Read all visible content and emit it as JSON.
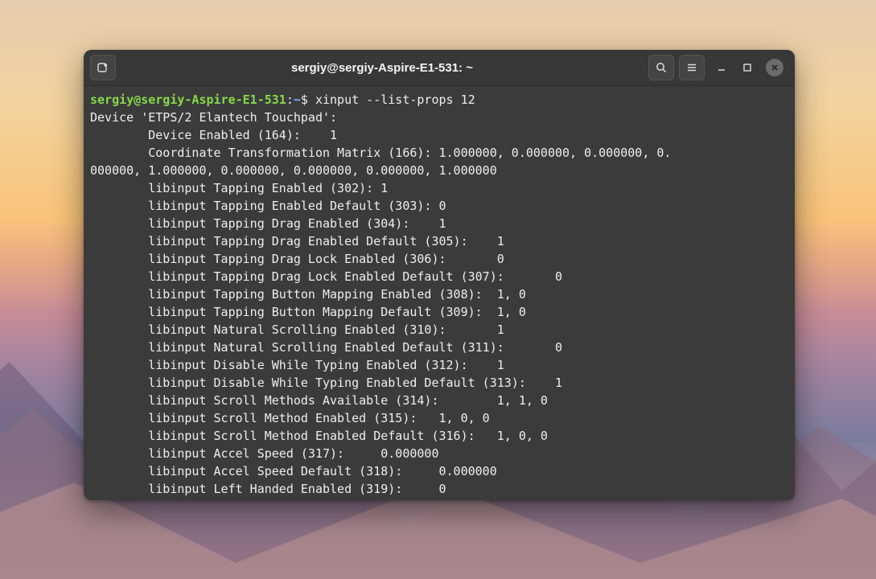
{
  "window": {
    "title": "sergiy@sergiy-Aspire-E1-531: ~"
  },
  "prompt": {
    "user_host": "sergiy@sergiy-Aspire-E1-531",
    "colon": ":",
    "path": "~",
    "dollar": "$ ",
    "command": "xinput --list-props 12"
  },
  "output_lines": [
    "Device 'ETPS/2 Elantech Touchpad':",
    "        Device Enabled (164):    1",
    "        Coordinate Transformation Matrix (166): 1.000000, 0.000000, 0.000000, 0.",
    "000000, 1.000000, 0.000000, 0.000000, 0.000000, 1.000000",
    "        libinput Tapping Enabled (302): 1",
    "        libinput Tapping Enabled Default (303): 0",
    "        libinput Tapping Drag Enabled (304):    1",
    "        libinput Tapping Drag Enabled Default (305):    1",
    "        libinput Tapping Drag Lock Enabled (306):       0",
    "        libinput Tapping Drag Lock Enabled Default (307):       0",
    "        libinput Tapping Button Mapping Enabled (308):  1, 0",
    "        libinput Tapping Button Mapping Default (309):  1, 0",
    "        libinput Natural Scrolling Enabled (310):       1",
    "        libinput Natural Scrolling Enabled Default (311):       0",
    "        libinput Disable While Typing Enabled (312):    1",
    "        libinput Disable While Typing Enabled Default (313):    1",
    "        libinput Scroll Methods Available (314):        1, 1, 0",
    "        libinput Scroll Method Enabled (315):   1, 0, 0",
    "        libinput Scroll Method Enabled Default (316):   1, 0, 0",
    "        libinput Accel Speed (317):     0.000000",
    "        libinput Accel Speed Default (318):     0.000000",
    "        libinput Left Handed Enabled (319):     0"
  ]
}
